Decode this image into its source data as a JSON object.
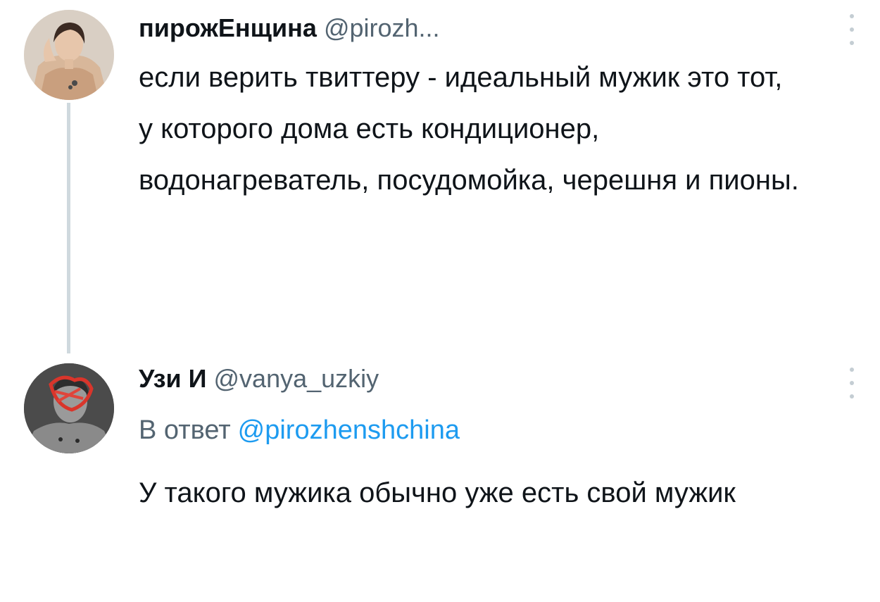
{
  "tweets": [
    {
      "display_name": "пирожЕнщина",
      "handle": "@pirozh...",
      "text": "если верить твиттеру - идеальный мужик это тот, у которого дома есть кондиционер, водонагреватель, посудомойка, черешня и пионы.",
      "avatar_icon": "avatar-photo",
      "menu_icon": "more-vertical-icon"
    },
    {
      "display_name": "Узи И",
      "handle": "@vanya_uzkiy",
      "reply_prefix": "В ответ",
      "reply_to": "@pirozhenshchina",
      "text": "У такого мужика обычно уже есть свой мужик",
      "avatar_icon": "avatar-photo",
      "menu_icon": "more-vertical-icon"
    }
  ],
  "colors": {
    "text": "#0f1419",
    "secondary": "#536471",
    "link": "#1d9bf0",
    "thread_line": "#cfd9de"
  }
}
